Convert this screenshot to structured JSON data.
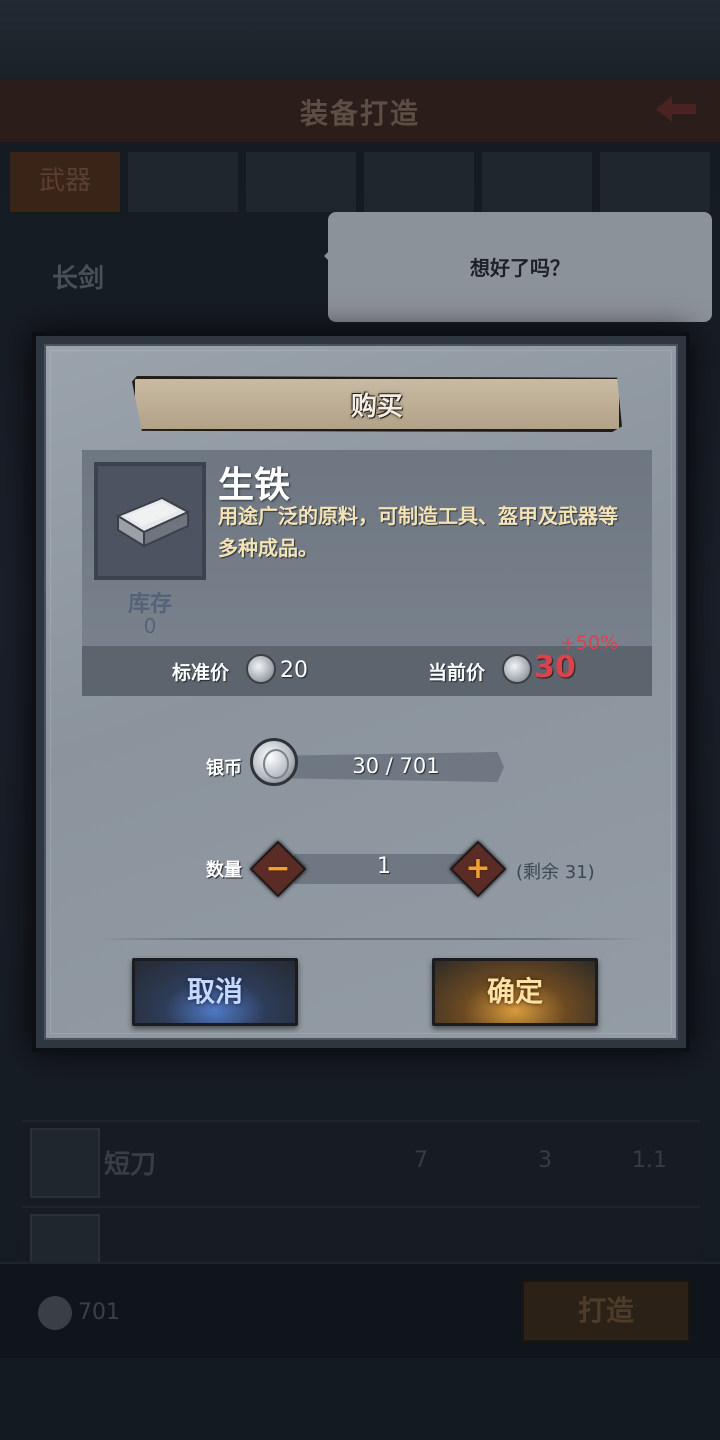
{
  "background": {
    "screen_title": "装备打造",
    "tabs": [
      "武器",
      "",
      "",
      "",
      "",
      ""
    ],
    "selected_item_title": "长剑",
    "speech_bubble": "想好了吗？",
    "list_rows": [
      {
        "name": "短刀",
        "values": [
          "7",
          "3",
          "1.1"
        ]
      }
    ],
    "coin_count": "701",
    "forge_button": "打造"
  },
  "dialog": {
    "title": "购买",
    "item": {
      "name": "生铁",
      "description": "用途广泛的原料，可制造工具、盔甲及武器等多种成品。",
      "stock_label": "库存",
      "stock_value": "0",
      "icon": "iron-ingot-icon"
    },
    "standard_price_label": "标准价",
    "standard_price": "20",
    "current_price_label": "当前价",
    "current_price": "30",
    "markup": "+50%",
    "silver_label": "银币",
    "silver_balance": "30 / 701",
    "quantity_label": "数量",
    "quantity": "1",
    "minus_glyph": "−",
    "plus_glyph": "+",
    "remaining": "(剩余 31)",
    "cancel_label": "取消",
    "confirm_label": "确定"
  },
  "colors": {
    "price_highlight": "#d9434d",
    "stepper_glyph": "#f0a22f",
    "description_text": "#f4e3b7"
  }
}
